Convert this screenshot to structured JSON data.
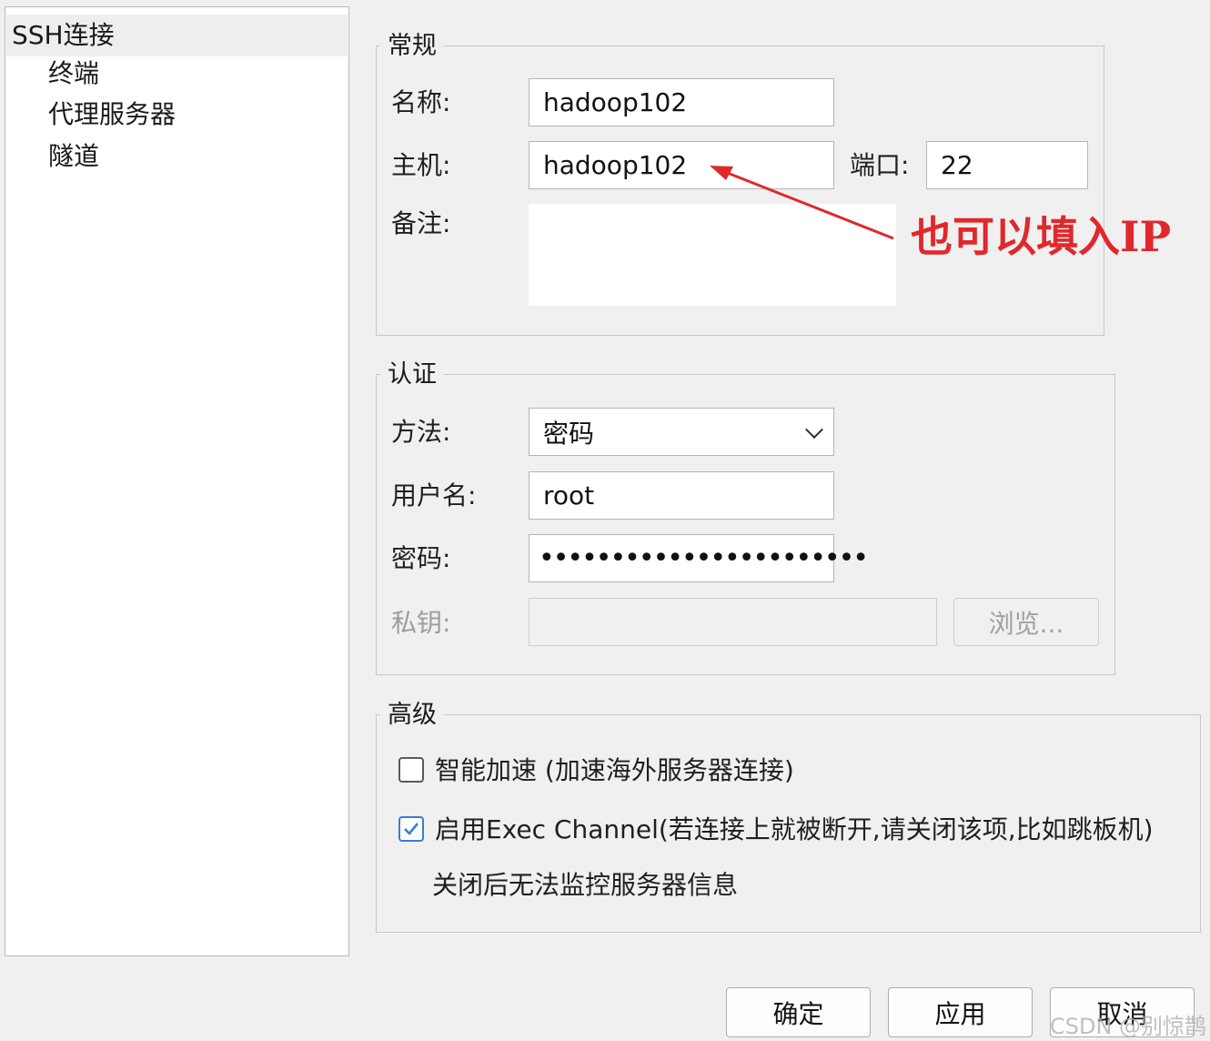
{
  "sidebar": {
    "items": [
      {
        "label": "SSH连接"
      },
      {
        "label": "终端"
      },
      {
        "label": "代理服务器"
      },
      {
        "label": "隧道"
      }
    ]
  },
  "general": {
    "legend": "常规",
    "name_label": "名称:",
    "name_value": "hadoop102",
    "host_label": "主机:",
    "host_value": "hadoop102",
    "port_label": "端口:",
    "port_value": "22",
    "note_label": "备注:",
    "note_value": ""
  },
  "annotation": {
    "text": "也可以填入IP",
    "color": "#e0282c"
  },
  "auth": {
    "legend": "认证",
    "method_label": "方法:",
    "method_value": "密码",
    "username_label": "用户名:",
    "username_value": "root",
    "password_label": "密码:",
    "password_value": "•••••••••••••••••••••••",
    "privatekey_label": "私钥:",
    "privatekey_value": "",
    "browse_label": "浏览..."
  },
  "advanced": {
    "legend": "高级",
    "smart_accel_label": "智能加速 (加速海外服务器连接)",
    "smart_accel_checked": false,
    "exec_channel_label": "启用Exec Channel(若连接上就被断开,请关闭该项,比如跳板机)",
    "exec_channel_checked": true,
    "exec_channel_note": "关闭后无法监控服务器信息"
  },
  "footer": {
    "ok_label": "确定",
    "apply_label": "应用",
    "cancel_label": "取消"
  },
  "watermark": "CSDN @别惊鹊",
  "colors": {
    "accent": "#3b7bd4",
    "background": "#f0f0f0"
  }
}
